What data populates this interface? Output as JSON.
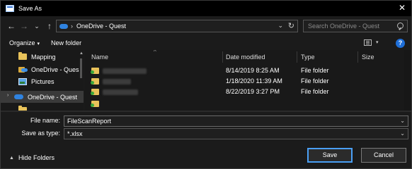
{
  "window": {
    "title": "Save As",
    "close": "✕"
  },
  "nav": {
    "back": "←",
    "forward": "→",
    "recent": "⌄",
    "up": "↑",
    "address_sep": "›",
    "address_path": "OneDrive - Quest",
    "address_dropdown": "⌄",
    "refresh": "↻",
    "search_placeholder": "Search OneDrive - Quest"
  },
  "toolbar": {
    "organize": "Organize",
    "organize_arrow": "▾",
    "new_folder": "New folder",
    "view_arrow": "▾",
    "help": "?"
  },
  "sidebar": {
    "items": [
      {
        "label": "Mapping",
        "icon": "folder-icon"
      },
      {
        "label": "OneDrive - Ques",
        "icon": "onedrive-folder-icon"
      },
      {
        "label": "Pictures",
        "icon": "pictures-icon"
      },
      {
        "label": "OneDrive - Quest",
        "icon": "onedrive-cloud-icon",
        "selected": true
      }
    ],
    "expand_chevron": "›",
    "scroll_up": "▲"
  },
  "columns": {
    "name": "Name",
    "date": "Date modified",
    "type": "Type",
    "size": "Size",
    "sort_caret": "^"
  },
  "files": [
    {
      "date": "8/14/2019 8:25 AM",
      "type": "File folder"
    },
    {
      "date": "1/18/2020 11:39 AM",
      "type": "File folder"
    },
    {
      "date": "8/22/2019 3:27 PM",
      "type": "File folder"
    }
  ],
  "form": {
    "file_name_label": "File name:",
    "file_name_value": "FileScanReport",
    "save_type_label": "Save as type:",
    "save_type_value": "*.xlsx",
    "dropdown_arrow": "⌄"
  },
  "footer": {
    "hide_folders": "Hide Folders",
    "hide_caret": "▲",
    "save": "Save",
    "cancel": "Cancel"
  },
  "colors": {
    "accent": "#4a9ff5",
    "background": "#1b1b1b",
    "folder": "#e8c25a",
    "onedrive": "#2f83e0"
  }
}
